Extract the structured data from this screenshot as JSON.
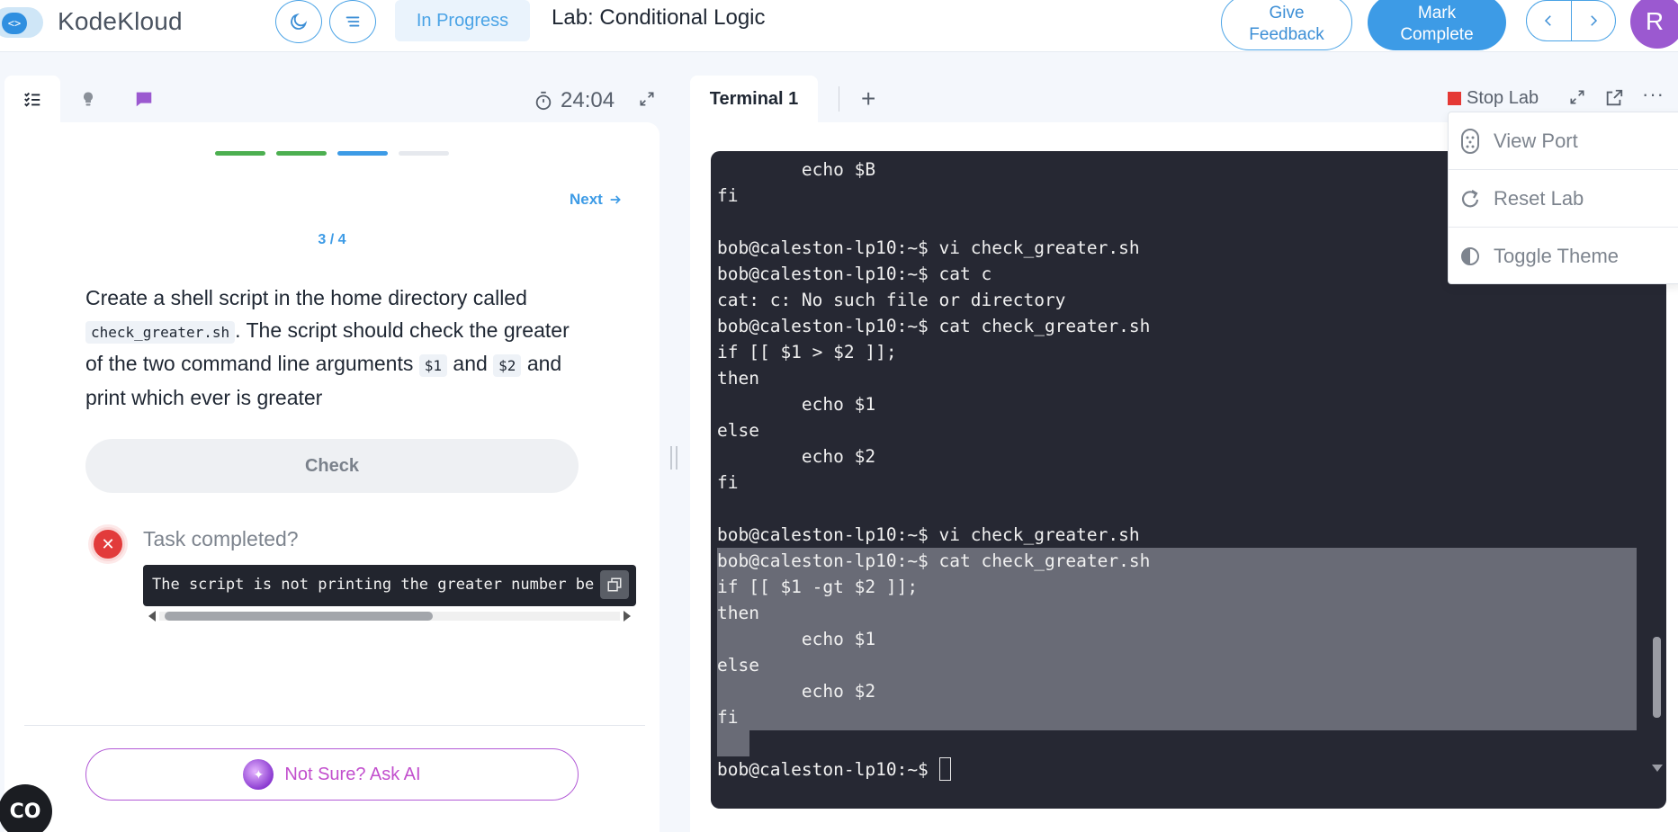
{
  "header": {
    "brand": "KodeKloud",
    "status": "In Progress",
    "lab_title": "Lab: Conditional Logic",
    "feedback_line1": "Give",
    "feedback_line2": "Feedback",
    "complete_line1": "Mark",
    "complete_line2": "Complete",
    "avatar_initial": "R"
  },
  "left": {
    "timer": "24:04",
    "next_label": "Next",
    "step_count": "3 / 4",
    "task": {
      "t1": "Create a shell script in the home directory called",
      "code1": "check_greater.sh",
      "t2": ". The script should check the greater of the two command line arguments",
      "code2": "$1",
      "t3": "and",
      "code3": "$2",
      "t4": "and print which ever is greater"
    },
    "check_label": "Check",
    "task_question": "Task completed?",
    "error_message": "The script is not printing the greater number be",
    "ask_ai_label": "Not Sure? Ask AI",
    "cc_badge": "CO"
  },
  "right": {
    "terminal_tab": "Terminal 1",
    "add_tab": "+",
    "stop_lab": "Stop Lab",
    "more": "···",
    "menu": {
      "view_port": "View Port",
      "reset_lab": "Reset Lab",
      "toggle_theme": "Toggle Theme"
    },
    "terminal_lines": {
      "l0": "        echo $B",
      "l1": "fi",
      "l2": "",
      "l3": "bob@caleston-lp10:~$ vi check_greater.sh",
      "l4": "bob@caleston-lp10:~$ cat c",
      "l5": "cat: c: No such file or directory",
      "l6": "bob@caleston-lp10:~$ cat check_greater.sh",
      "l7": "if [[ $1 > $2 ]];",
      "l8": "then",
      "l9": "        echo $1",
      "l10": "else",
      "l11": "        echo $2",
      "l12": "fi",
      "l13": "",
      "l14": "bob@caleston-lp10:~$ vi check_greater.sh",
      "l15": "bob@caleston-lp10:~$ cat check_greater.sh",
      "l16": "if [[ $1 -gt $2 ]];",
      "l17": "then",
      "l18": "        echo $1",
      "l19": "else",
      "l20": "        echo $2",
      "l21": "fi",
      "l22": "",
      "l23": "bob@caleston-lp10:~$ "
    }
  },
  "colors": {
    "accent": "#3d9be6",
    "terminal_bg": "#262833",
    "selection": "#696b76",
    "error": "#e23b3b",
    "progress_done": "#4caf50",
    "progress_current": "#3d9be6",
    "progress_todo": "#e6e9ee"
  }
}
